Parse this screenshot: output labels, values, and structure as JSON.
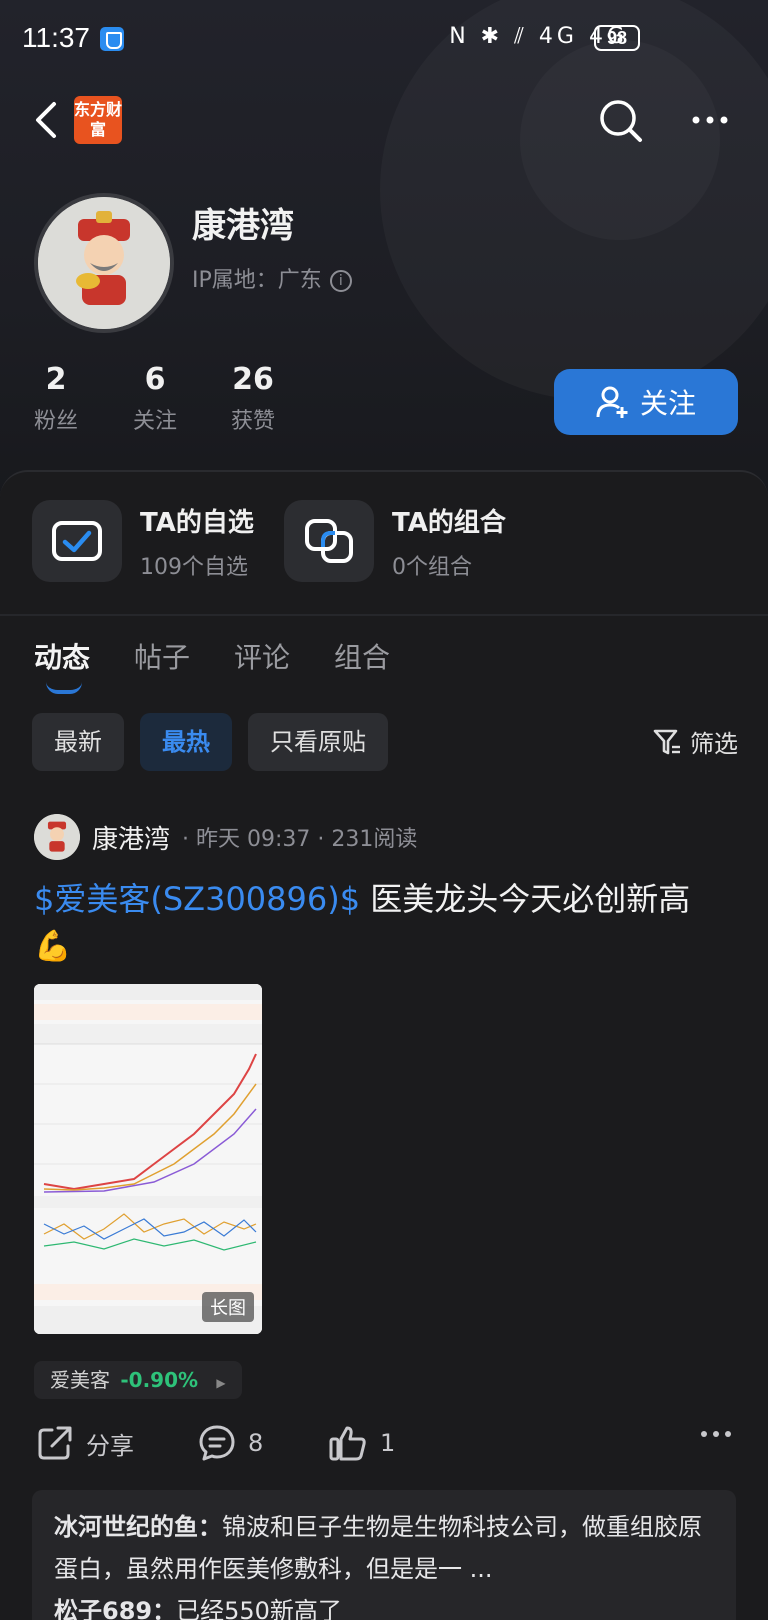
{
  "status_bar": {
    "time": "11:37",
    "icons": "N ✱ ⫽ 4G 4G",
    "battery": "98"
  },
  "header": {
    "logo_text": "东方财富"
  },
  "profile": {
    "name": "康港湾",
    "ip_label": "IP属地：广东",
    "stats": [
      {
        "num": "2",
        "label": "粉丝"
      },
      {
        "num": "6",
        "label": "关注"
      },
      {
        "num": "26",
        "label": "获赞"
      }
    ],
    "follow_label": "关注"
  },
  "features": [
    {
      "title": "TA的自选",
      "sub": "109个自选"
    },
    {
      "title": "TA的组合",
      "sub": "0个组合"
    }
  ],
  "tabs": [
    "动态",
    "帖子",
    "评论",
    "组合"
  ],
  "chips": [
    "最新",
    "最热",
    "只看原贴"
  ],
  "filter_label": "筛选",
  "post": {
    "user": "康港湾",
    "meta": "· 昨天 09:37 · 231阅读",
    "stock_link": "$爱美客(SZ300896)$",
    "text": " 医美龙头今天必创新高",
    "emoji": "💪",
    "image_tag": "长图",
    "stock_tag": {
      "name": "爱美客",
      "change": "-0.90%",
      "arrow": "▶"
    },
    "share_label": "分享",
    "comment_count": "8",
    "like_count": "1"
  },
  "comments": [
    {
      "who": "冰河世纪的鱼：",
      "text": "锦波和巨子生物是生物科技公司，做重组胶原蛋白，虽然用作医美修敷科，但是是一 ..."
    },
    {
      "who": "松子689：",
      "text": "已经550新高了"
    }
  ],
  "colors": {
    "accent": "#2a77d6",
    "link": "#3a8bf0",
    "down": "#2ec27a",
    "logo": "#e8531f"
  }
}
